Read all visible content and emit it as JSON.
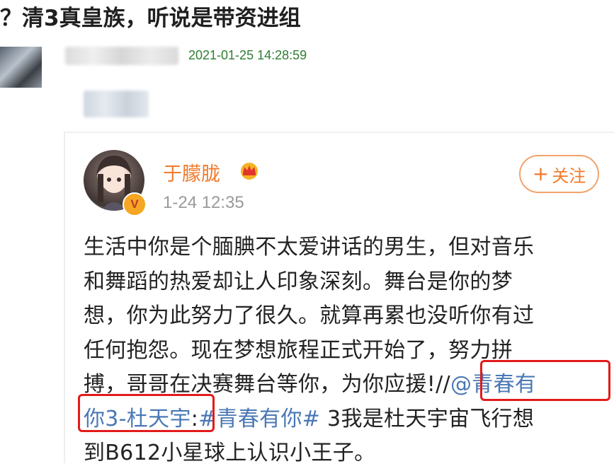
{
  "post_title": "？清3真皇族，听说是带资进组",
  "comment": {
    "timestamp": "2021-01-25 14:28:59"
  },
  "weibo_post": {
    "username": "于朦胧",
    "time": "1-24 12:35",
    "follow_label": "关注",
    "verified_badge": "V",
    "content": {
      "line1": "生活中你是个腼腆不太爱讲话的男生，但对音乐",
      "line2": "和舞蹈的热爱却让人印象深刻。舞台是你的梦",
      "line3": "想，你为此努力了很久。就算再累也没听你有过",
      "line4": "任何抱怨。现在梦想旅程正式开始了，努力拼",
      "line5_text": "搏，哥哥在决赛舞台等你，为你应援!",
      "line5_slash": "//",
      "line5_link": "@青春有",
      "line6_link": "你3-杜天宇",
      "line6_colon": ":",
      "line6_hashtag": "#青春有你#",
      "line6_text": " 3我是杜天宇宙飞行想",
      "line7": "到B612小星球上认识小王子。"
    }
  },
  "colors": {
    "username": "#f07a2a",
    "link": "#4a78b5",
    "timestamp": "#2e7d32",
    "highlight_box": "#e21b1b"
  }
}
